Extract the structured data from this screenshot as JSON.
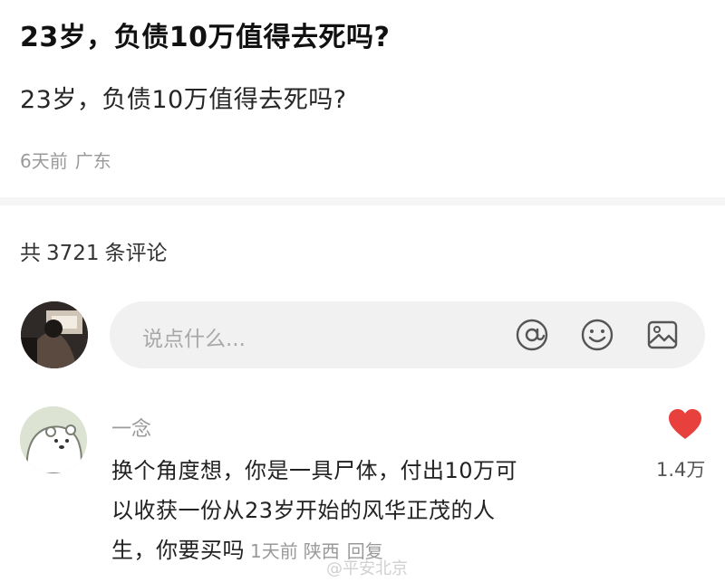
{
  "post": {
    "title": "23岁，负债10万值得去死吗?",
    "body": "23岁，负债10万值得去死吗?",
    "time": "6天前",
    "location": "广东"
  },
  "comments_header": {
    "prefix": "共",
    "count": "3721",
    "suffix": "条评论"
  },
  "composer": {
    "placeholder": "说点什么...",
    "icons": [
      "at-icon",
      "emoji-icon",
      "image-icon"
    ]
  },
  "comment": {
    "author": "一念",
    "text_lines": [
      "换个角度想，你是一具尸体，付出10万可",
      "以收获一份从23岁开始的风华正茂的人",
      "生，你要买吗"
    ],
    "time": "1天前",
    "location": "陕西",
    "reply_label": "回复",
    "like_count": "1.4万"
  },
  "watermark": "@平安北京",
  "colors": {
    "like": "#e8413d",
    "muted_text": "#9a9a9a",
    "input_bg": "#f1f1f1"
  }
}
